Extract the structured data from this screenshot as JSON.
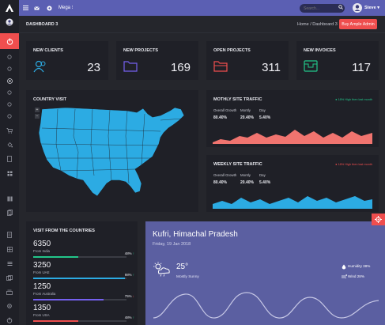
{
  "topbar": {
    "mega_label": "Mega",
    "search_placeholder": "Search...",
    "user_name": "Steve"
  },
  "breadcrumb": {
    "page_title": "DASHBOARD 3",
    "trail": "Home  /  Dashboard 3",
    "buy_button": "Buy Ample Admin"
  },
  "stats": [
    {
      "label": "NEW CLIENTS",
      "value": "23",
      "color": "#2cabe3",
      "icon": "users-icon"
    },
    {
      "label": "NEW PROJECTS",
      "value": "169",
      "color": "#7460ee",
      "icon": "folder-icon"
    },
    {
      "label": "OPEN PROJECTS",
      "value": "311",
      "color": "#ef4e4e",
      "icon": "folder-open-icon"
    },
    {
      "label": "NEW INVOICES",
      "value": "117",
      "color": "#22c68a",
      "icon": "invoice-icon"
    }
  ],
  "country_visit": {
    "title": "COUNTRY VISIT",
    "map_color": "#2cabe3"
  },
  "monthly": {
    "title": "MOTHLY SITE TRAFFIC",
    "note": "● 18% High then last month",
    "note_color": "#22c68a",
    "heads": [
      "Overall Growth",
      "Montly",
      "Day"
    ],
    "values": [
      "80.40%",
      "20.40%",
      "5.40%"
    ],
    "chart_color": "#f0746f"
  },
  "weekly": {
    "title": "WEEKLY SITE TRAFFIC",
    "note": "● 18% High then last month",
    "note_color": "#ef4e4e",
    "heads": [
      "Overall Growth",
      "Montly",
      "Day"
    ],
    "values": [
      "80.40%",
      "20.40%",
      "5.40%"
    ],
    "chart_color": "#2cabe3"
  },
  "countries": {
    "title": "VISIT FROM THE COUNTRIES",
    "rows": [
      {
        "value": "6350",
        "from": "From India",
        "pct": "48%",
        "trend": "↑",
        "trend_color": "#22c68a",
        "fill": 0.48,
        "color": "#22c68a"
      },
      {
        "value": "3250",
        "from": "From UAE",
        "pct": "98%",
        "trend": "↑",
        "trend_color": "#22c68a",
        "fill": 0.98,
        "color": "#2cabe3"
      },
      {
        "value": "1250",
        "from": "From Australia",
        "pct": "75%",
        "trend": "↓",
        "trend_color": "#ef4e4e",
        "fill": 0.75,
        "color": "#7460ee"
      },
      {
        "value": "1350",
        "from": "From USA",
        "pct": "48%",
        "trend": "↑",
        "trend_color": "#22c68a",
        "fill": 0.48,
        "color": "#ef4e4e"
      }
    ]
  },
  "weather": {
    "city": "Kufri, Himachal Pradesh",
    "date": "Friday, 19 Jan 2018",
    "temp": "25°",
    "condition": "Mostly Sunny",
    "humidity": "Humidity 38%",
    "wind": "Wind 28%"
  }
}
